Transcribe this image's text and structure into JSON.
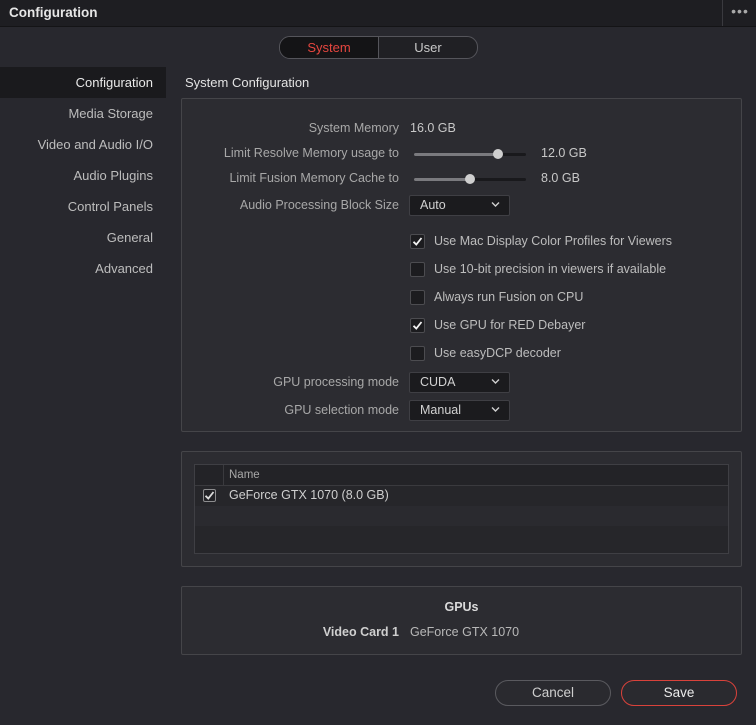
{
  "window": {
    "title": "Configuration",
    "more_icon": "ellipsis-icon"
  },
  "tabs": [
    {
      "label": "System",
      "active": true
    },
    {
      "label": "User",
      "active": false
    }
  ],
  "sidebar": {
    "items": [
      {
        "label": "Configuration",
        "active": true
      },
      {
        "label": "Media Storage"
      },
      {
        "label": "Video and Audio I/O"
      },
      {
        "label": "Audio Plugins"
      },
      {
        "label": "Control Panels"
      },
      {
        "label": "General"
      },
      {
        "label": "Advanced"
      }
    ]
  },
  "system_config": {
    "section_title": "System Configuration",
    "system_memory": {
      "label": "System Memory",
      "value": "16.0 GB"
    },
    "resolve_memory": {
      "label": "Limit Resolve Memory usage to",
      "value": "12.0 GB",
      "fraction": 0.75
    },
    "fusion_memory": {
      "label": "Limit Fusion Memory Cache to",
      "value": "8.0 GB",
      "fraction": 0.5
    },
    "audio_block": {
      "label": "Audio Processing Block Size",
      "value": "Auto"
    },
    "checkboxes": [
      {
        "label": "Use Mac Display Color Profiles for Viewers",
        "checked": true
      },
      {
        "label": "Use 10-bit precision in viewers if available",
        "checked": false
      },
      {
        "label": "Always run Fusion on CPU",
        "checked": false
      },
      {
        "label": "Use GPU for RED Debayer",
        "checked": true
      },
      {
        "label": "Use easyDCP decoder",
        "checked": false
      }
    ],
    "gpu_processing": {
      "label": "GPU processing mode",
      "value": "CUDA"
    },
    "gpu_selection": {
      "label": "GPU selection mode",
      "value": "Manual"
    }
  },
  "gpu_table": {
    "header": "Name",
    "rows": [
      {
        "name": "GeForce GTX 1070 (8.0 GB)",
        "checked": true
      }
    ]
  },
  "gpus": {
    "title": "GPUs",
    "video_card_label": "Video Card 1",
    "video_card_value": "GeForce GTX 1070"
  },
  "buttons": {
    "cancel": "Cancel",
    "save": "Save"
  },
  "colors": {
    "accent": "#e5463f",
    "save_border": "#d9423b",
    "background": "#28282e"
  }
}
